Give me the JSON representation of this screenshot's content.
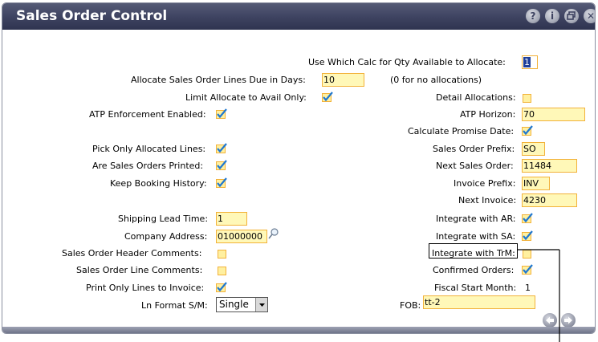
{
  "window": {
    "title": "Sales Order Control",
    "buttons": {
      "help": "?",
      "info": "i",
      "restore": "restore-icon",
      "close": "✕"
    }
  },
  "left": {
    "allocate_days_label": "Allocate Sales Order Lines Due in Days:",
    "allocate_days_value": "10",
    "limit_allocate_label": "Limit Allocate to Avail Only:",
    "limit_allocate_checked": true,
    "atp_enforcement_label": "ATP Enforcement Enabled:",
    "atp_enforcement_checked": true,
    "pick_only_label": "Pick Only Allocated Lines:",
    "pick_only_checked": true,
    "sales_orders_printed_label": "Are Sales Orders Printed:",
    "sales_orders_printed_checked": true,
    "keep_booking_label": "Keep Booking History:",
    "keep_booking_checked": true,
    "shipping_lead_label": "Shipping Lead Time:",
    "shipping_lead_value": "1",
    "company_address_label": "Company Address:",
    "company_address_value": "01000000",
    "so_header_comments_label": "Sales Order Header Comments:",
    "so_header_comments_checked": false,
    "so_line_comments_label": "Sales Order Line Comments:",
    "so_line_comments_checked": false,
    "print_only_lines_label": "Print Only Lines to Invoice:",
    "print_only_lines_checked": true,
    "ln_format_label": "Ln Format S/M:",
    "ln_format_value": "Single"
  },
  "right": {
    "qty_calc_label": "Use Which Calc for Qty Available to Allocate:",
    "qty_calc_value": "1",
    "no_alloc_note": "(0 for no allocations)",
    "detail_alloc_label": "Detail Allocations:",
    "detail_alloc_checked": false,
    "atp_horizon_label": "ATP Horizon:",
    "atp_horizon_value": "70",
    "calc_promise_label": "Calculate Promise Date:",
    "calc_promise_checked": true,
    "so_prefix_label": "Sales Order Prefix:",
    "so_prefix_value": "SO",
    "next_so_label": "Next Sales Order:",
    "next_so_value": "11484",
    "invoice_prefix_label": "Invoice Prefix:",
    "invoice_prefix_value": "INV",
    "next_invoice_label": "Next Invoice:",
    "next_invoice_value": "4230",
    "integrate_ar_label": "Integrate with AR:",
    "integrate_ar_checked": true,
    "integrate_sa_label": "Integrate with SA:",
    "integrate_sa_checked": true,
    "integrate_trm_label": "Integrate with TrM:",
    "integrate_trm_checked": false,
    "confirmed_orders_label": "Confirmed Orders:",
    "confirmed_orders_checked": true,
    "fiscal_start_label": "Fiscal Start Month:",
    "fiscal_start_value": "1",
    "fob_label": "FOB:",
    "fob_value": "tt-2"
  },
  "colors": {
    "titlebar": "#3d4260",
    "field_bg": "#fff8b8",
    "field_border": "#f2b23a",
    "check": "#2a7fd4"
  }
}
